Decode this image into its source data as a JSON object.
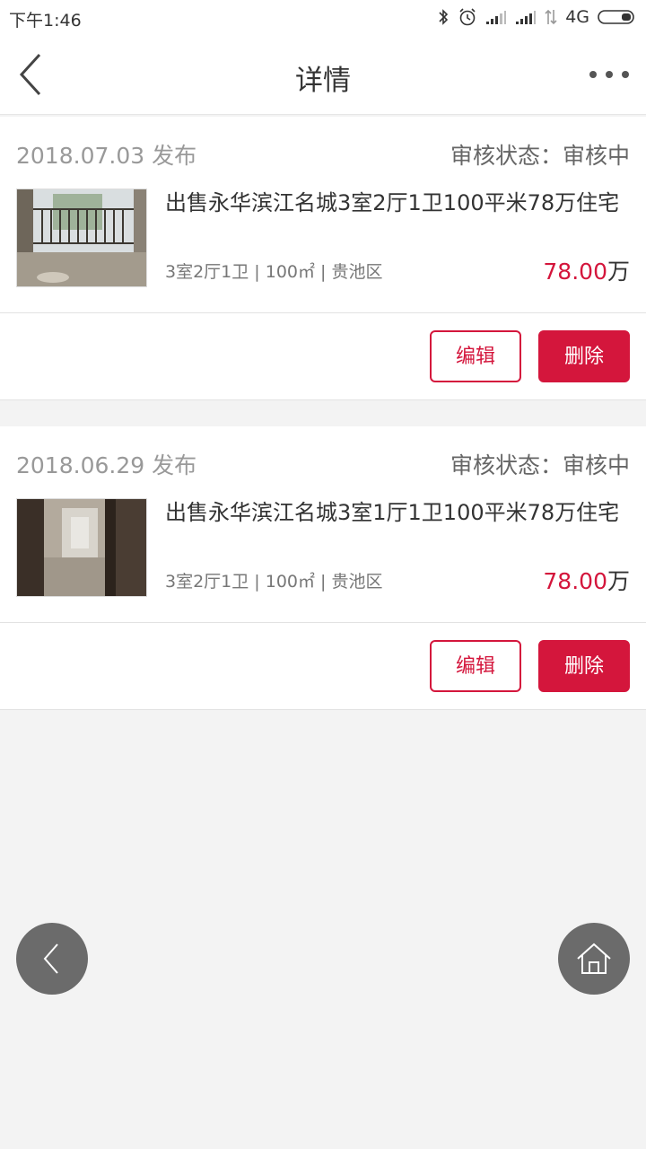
{
  "status_bar": {
    "time": "下午1:46",
    "network": "4G",
    "icons": [
      "bluetooth-icon",
      "alarm-icon",
      "signal-icon",
      "signal-icon",
      "data-arrows-icon",
      "battery-icon"
    ]
  },
  "nav": {
    "title": "详情",
    "back_icon": "chevron-left-icon",
    "more_icon": "more-dots-icon"
  },
  "listings": [
    {
      "date": "2018.07.03 发布",
      "status": "审核状态：审核中",
      "title": "出售永华滨江名城3室2厅1卫100平米78万住宅",
      "meta": "3室2厅1卫 | 100㎡ | 贵池区",
      "price": "78.00",
      "price_unit": "万",
      "edit_label": "编辑",
      "delete_label": "删除"
    },
    {
      "date": "2018.06.29 发布",
      "status": "审核状态：审核中",
      "title": "出售永华滨江名城3室1厅1卫100平米78万住宅",
      "meta": "3室2厅1卫 | 100㎡ | 贵池区",
      "price": "78.00",
      "price_unit": "万",
      "edit_label": "编辑",
      "delete_label": "删除"
    }
  ],
  "colors": {
    "accent": "#d4163c",
    "float_button": "#6b6b6b",
    "background": "#f3f3f3"
  },
  "floating": {
    "back_icon": "chevron-left-icon",
    "home_icon": "home-icon"
  }
}
